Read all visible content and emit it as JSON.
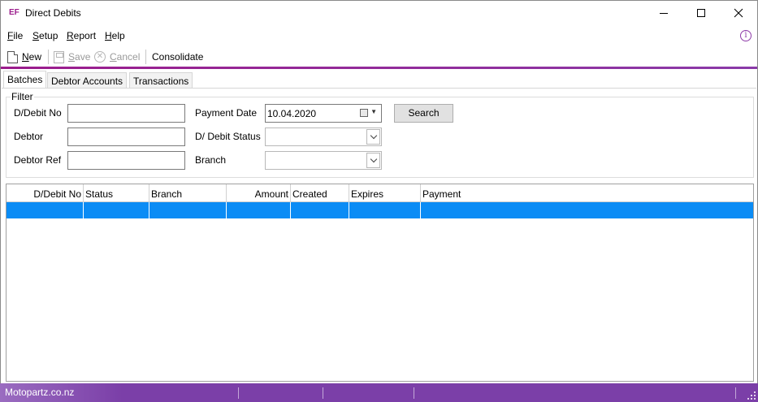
{
  "window": {
    "logo": "EF",
    "title": "Direct Debits"
  },
  "menu": {
    "file": {
      "u": "F",
      "rest": "ile"
    },
    "setup": {
      "u": "S",
      "rest": "etup"
    },
    "report": {
      "u": "R",
      "rest": "eport"
    },
    "help": {
      "u": "H",
      "rest": "elp"
    }
  },
  "toolbar": {
    "new": {
      "u": "N",
      "rest": "ew"
    },
    "save": {
      "u": "S",
      "rest": "ave"
    },
    "cancel": {
      "u": "C",
      "rest": "ancel"
    },
    "consolidate": "Consolidate"
  },
  "tabs": [
    "Batches",
    "Debtor Accounts",
    "Transactions"
  ],
  "filter": {
    "legend": "Filter",
    "debit_no_label": "D/Debit No",
    "debtor_label": "Debtor",
    "debtor_ref_label": "Debtor Ref",
    "payment_date_label": "Payment Date",
    "payment_date_value": "10.04.2020",
    "debit_status_label": "D/ Debit Status",
    "debit_status_value": "",
    "branch_label": "Branch",
    "branch_value": "",
    "search_label": "Search"
  },
  "grid": {
    "columns": [
      "D/Debit No",
      "Status",
      "Branch",
      "Amount",
      "Created",
      "Expires",
      "Payment"
    ],
    "rows": [
      [
        "",
        "",
        "",
        "",
        "",
        "",
        ""
      ]
    ]
  },
  "status": {
    "text": "Motopartz.co.nz"
  },
  "colors": {
    "accent": "#9b1c8c",
    "status_bar": "#7b3fa8",
    "selection": "#0b8cf5",
    "icon_info": "#8e3aa8"
  }
}
